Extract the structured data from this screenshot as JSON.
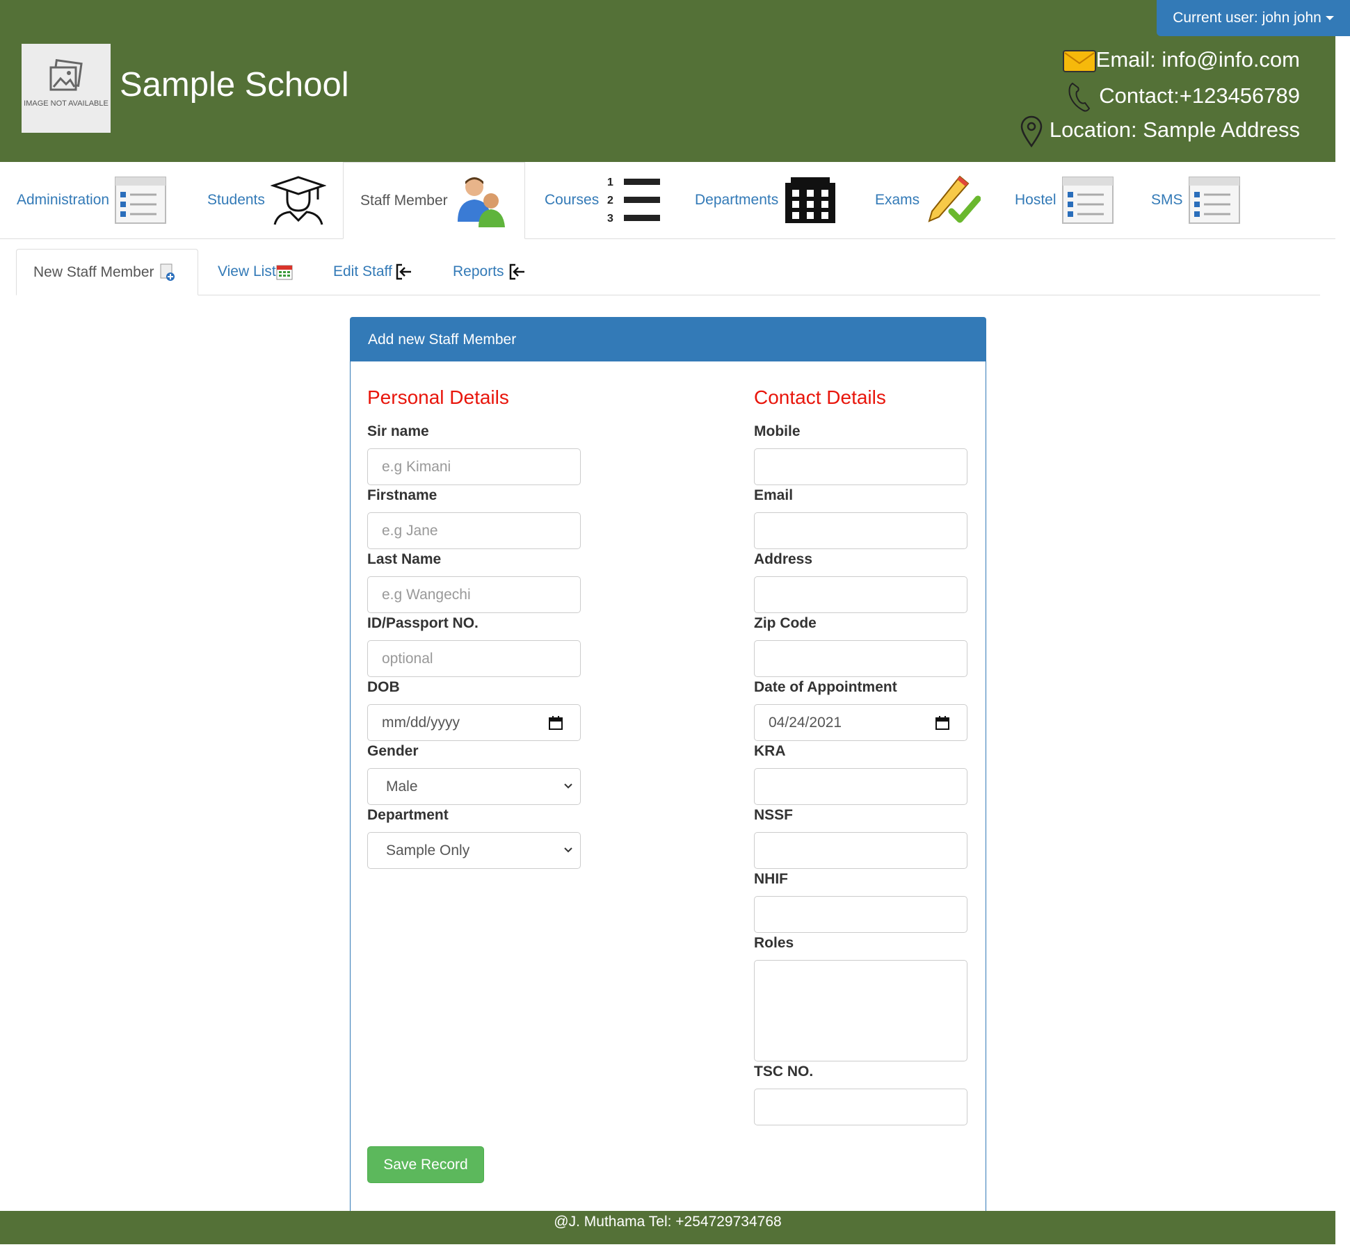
{
  "header": {
    "logo_text": "IMAGE NOT AVAILABLE",
    "school_name": "Sample School",
    "user_button": "Current user: john john",
    "email": "Email: info@info.com",
    "contact": "Contact:+123456789",
    "location": "Location: Sample Address"
  },
  "nav": {
    "items": [
      {
        "label": "Administration",
        "icon": "list-icon"
      },
      {
        "label": "Students",
        "icon": "graduate-icon"
      },
      {
        "label": "Staff Member",
        "icon": "staff-icon"
      },
      {
        "label": "Courses",
        "icon": "numbered-list-icon"
      },
      {
        "label": "Departments",
        "icon": "building-icon"
      },
      {
        "label": "Exams",
        "icon": "pencil-check-icon"
      },
      {
        "label": "Hostel",
        "icon": "list-icon"
      },
      {
        "label": "SMS",
        "icon": "list-icon"
      }
    ],
    "active": "Staff Member"
  },
  "subtabs": {
    "items": [
      {
        "label": "New Staff Member",
        "icon": "new-doc-icon"
      },
      {
        "label": "View List",
        "icon": "calendar-icon"
      },
      {
        "label": "Edit Staff",
        "icon": "exit-icon"
      },
      {
        "label": "Reports",
        "icon": "exit-icon"
      }
    ],
    "active": "New Staff Member"
  },
  "form": {
    "title": "Add new Staff Member",
    "personal_heading": "Personal Details",
    "contact_heading": "Contact Details",
    "personal": {
      "surname_label": "Sir name",
      "surname_placeholder": "e.g Kimani",
      "firstname_label": "Firstname",
      "firstname_placeholder": "e.g Jane",
      "lastname_label": "Last Name",
      "lastname_placeholder": "e.g Wangechi",
      "id_label": "ID/Passport NO.",
      "id_placeholder": "optional",
      "dob_label": "DOB",
      "dob_value": "mm/dd/yyyy",
      "gender_label": "Gender",
      "gender_value": "Male",
      "department_label": "Department",
      "department_value": "Sample Only"
    },
    "contact": {
      "mobile_label": "Mobile",
      "email_label": "Email",
      "address_label": "Address",
      "zip_label": "Zip Code",
      "appointment_label": "Date of Appointment",
      "appointment_value": "04/24/2021",
      "kra_label": "KRA",
      "nssf_label": "NSSF",
      "nhif_label": "NHIF",
      "roles_label": "Roles",
      "tsc_label": "TSC NO."
    },
    "save_label": "Save Record"
  },
  "footer": {
    "text": "@J. Muthama Tel: +254729734768"
  },
  "colors": {
    "header_bg": "#547137",
    "primary": "#337ab7",
    "section_heading": "#e8150b",
    "save_button": "#5cb85c"
  }
}
